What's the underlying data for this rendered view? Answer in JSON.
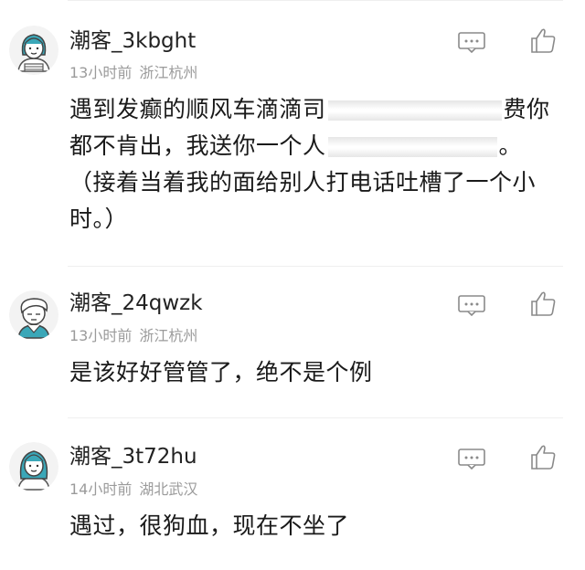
{
  "colors": {
    "text": "#1a1a1a",
    "meta": "#9b9b9b",
    "icon": "#8a8a8a",
    "avatar_teal": "#3aa7b8",
    "divider": "#efefef"
  },
  "comments": [
    {
      "username": "潮客_3kbght",
      "time": "13小时前",
      "location": "浙江杭州",
      "avatar_icon": "girl-avatar-icon",
      "text_parts": [
        "遇到发癫的顺风车滴滴司",
        "费你",
        "都不肯出，我送你一个人",
        "。",
        "（接着当着我的面给别人打电话吐槽了一个小时。）"
      ]
    },
    {
      "username": "潮客_24qwzk",
      "time": "13小时前",
      "location": "浙江杭州",
      "avatar_icon": "boy-avatar-icon",
      "text": "是该好好管管了，绝不是个例"
    },
    {
      "username": "潮客_3t72hu",
      "time": "14小时前",
      "location": "湖北武汉",
      "avatar_icon": "girl-avatar-icon",
      "text": "遇过，很狗血，现在不坐了"
    }
  ]
}
